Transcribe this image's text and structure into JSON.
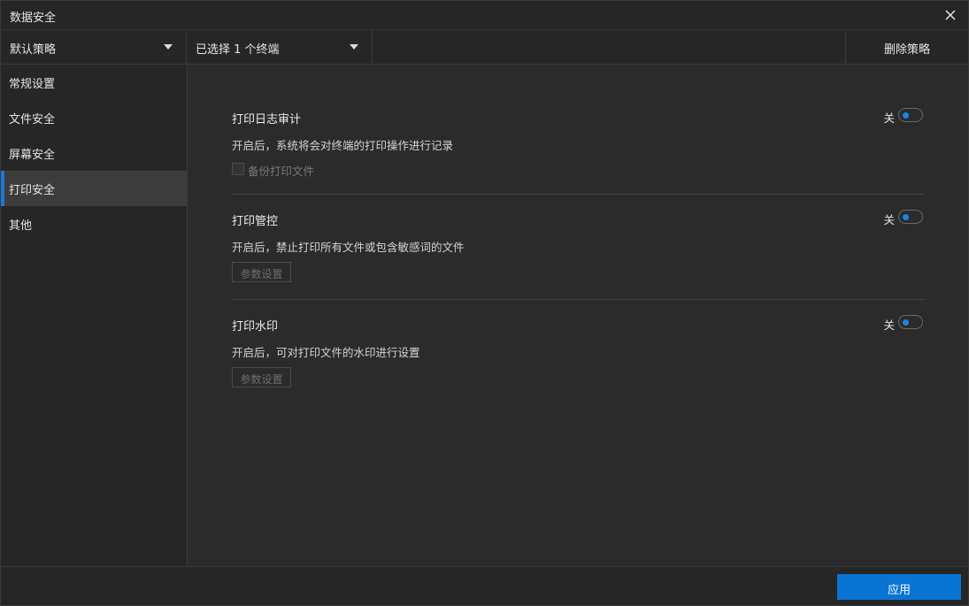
{
  "window": {
    "title": "数据安全"
  },
  "toolbar": {
    "policy_select": "默认策略",
    "terminal_select": "已选择 1 个终端",
    "delete_policy": "删除策略"
  },
  "sidebar": {
    "items": [
      {
        "label": "常规设置",
        "active": false
      },
      {
        "label": "文件安全",
        "active": false
      },
      {
        "label": "屏幕安全",
        "active": false
      },
      {
        "label": "打印安全",
        "active": true
      },
      {
        "label": "其他",
        "active": false
      }
    ]
  },
  "sections": [
    {
      "title": "打印日志审计",
      "toggle_state": "关",
      "description": "开启后，系统将会对终端的打印操作进行记录",
      "checkbox_label": "备份打印文件",
      "checkbox_checked": false
    },
    {
      "title": "打印管控",
      "toggle_state": "关",
      "description": "开启后，禁止打印所有文件或包含敏感词的文件",
      "button_label": "参数设置"
    },
    {
      "title": "打印水印",
      "toggle_state": "关",
      "description": "开启后，可对打印文件的水印进行设置",
      "button_label": "参数设置"
    }
  ],
  "footer": {
    "apply_label": "应用"
  },
  "colors": {
    "accent": "#0a74d4",
    "background": "#262626",
    "content_bg": "#2b2b2b"
  }
}
